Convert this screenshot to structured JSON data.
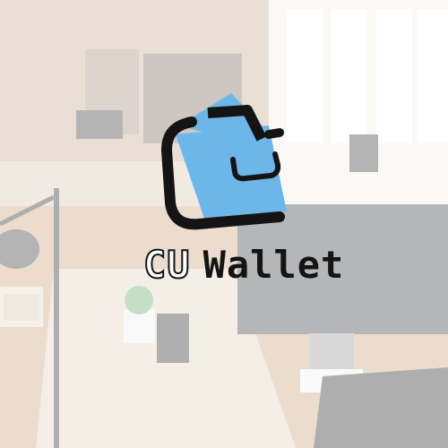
{
  "logo": {
    "prefix": "CU",
    "name": "Wallet",
    "wallet_fill": "#6cb6ea",
    "wallet_stroke": "#141414"
  },
  "background": {
    "description_visible_text": "",
    "tone": "#e9dfd3"
  }
}
